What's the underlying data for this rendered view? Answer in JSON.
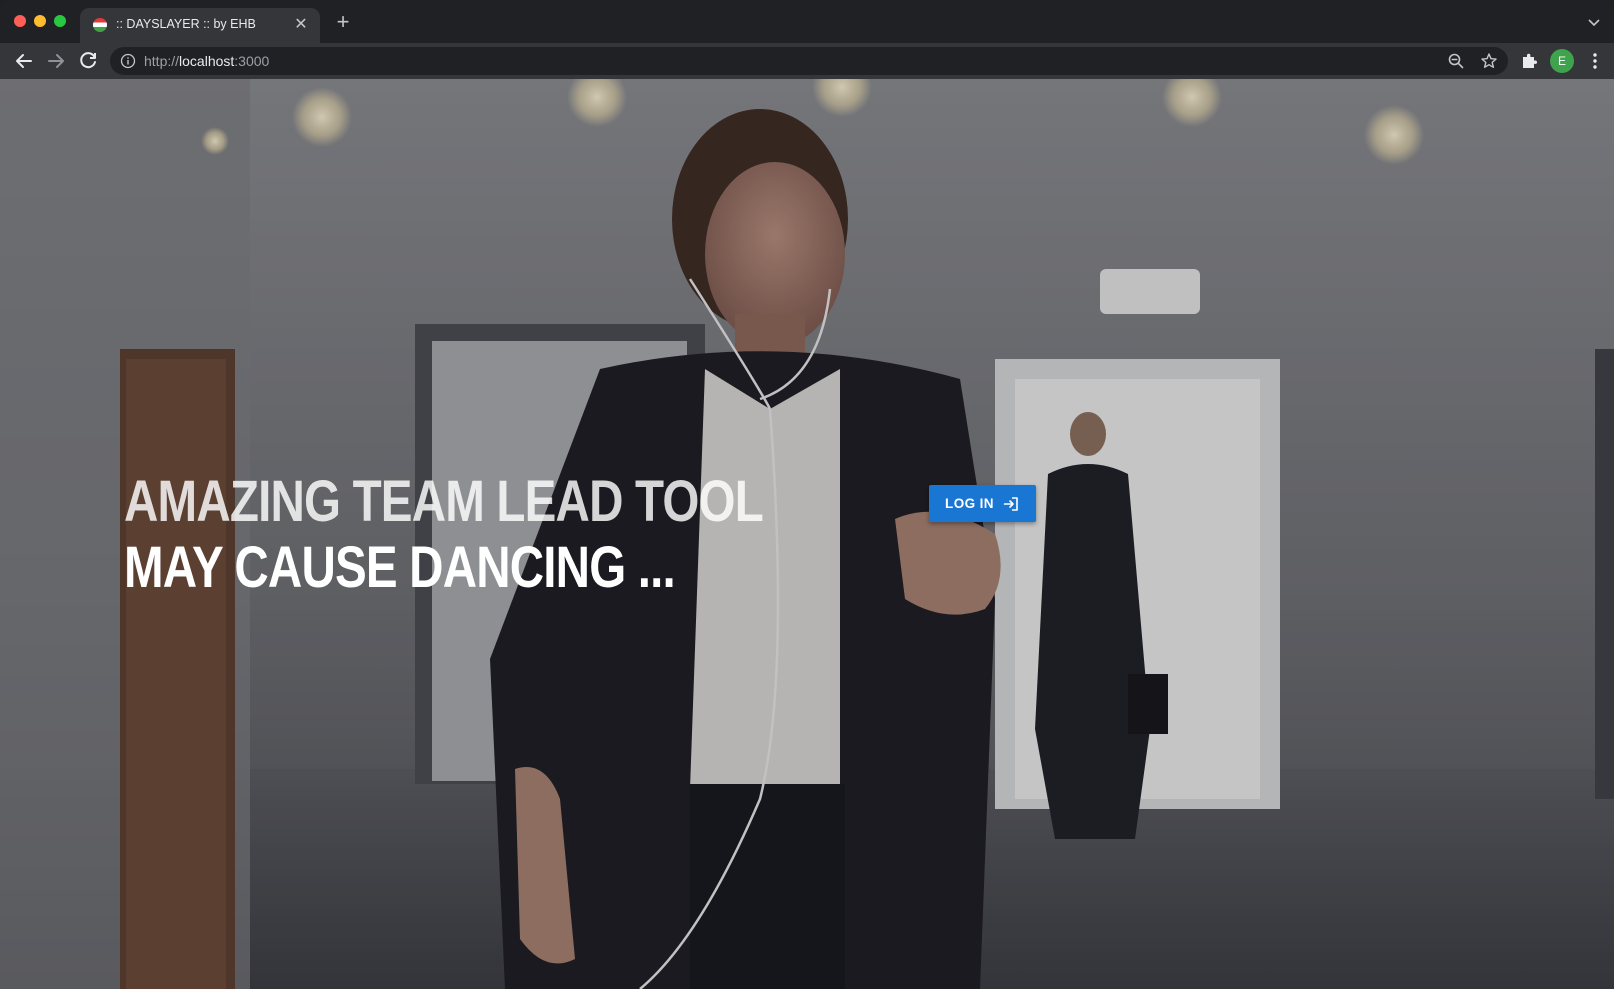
{
  "browser": {
    "tab_title": ":: DAYSLAYER :: by EHB",
    "url_scheme": "http://",
    "url_host": "localhost",
    "url_port": ":3000",
    "profile_initial": "E"
  },
  "hero": {
    "headline_line1": "AMAZING TEAM LEAD TOOL",
    "headline_line2": "MAY CAUSE DANCING ...",
    "login_label": "LOG IN"
  },
  "colors": {
    "accent": "#1976d2",
    "chrome_dark": "#202124",
    "chrome_toolbar": "#35363a"
  },
  "icons": {
    "favicon": "hungary-flag-icon",
    "close": "close-icon",
    "new_tab": "plus-icon",
    "back": "arrow-left-icon",
    "forward": "arrow-right-icon",
    "reload": "reload-icon",
    "site_info": "info-icon",
    "zoom": "zoom-icon",
    "bookmark": "star-icon",
    "extensions": "puzzle-icon",
    "menu": "kebab-menu-icon",
    "login": "login-arrow-icon"
  }
}
